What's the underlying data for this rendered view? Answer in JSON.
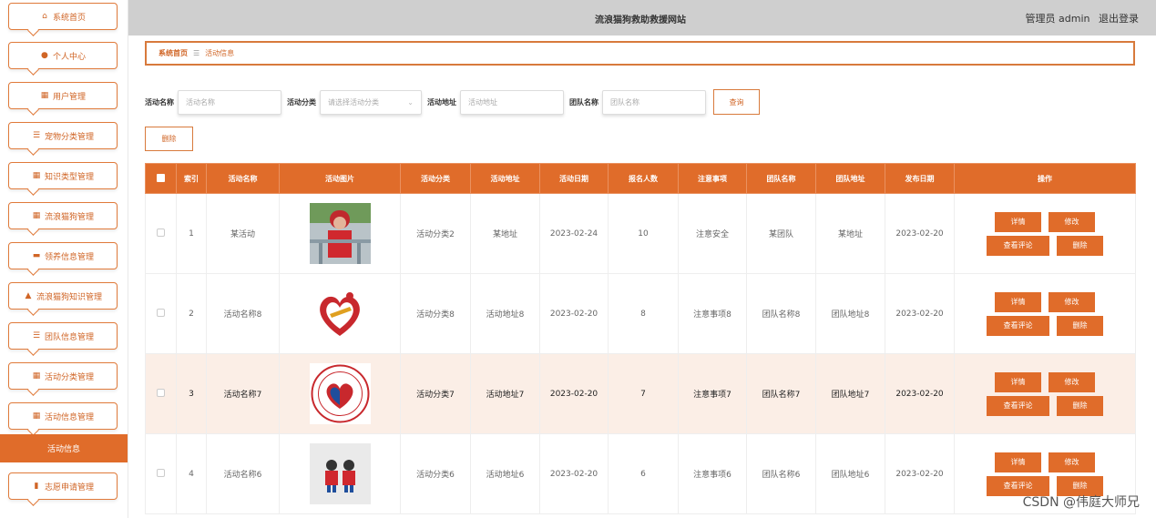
{
  "header": {
    "site_title": "流浪猫狗救助救援网站",
    "user": "管理员 admin",
    "logout": "退出登录"
  },
  "sidebar": {
    "items": [
      {
        "label": "系统首页",
        "icon": "home-icon",
        "glyph": "⌂"
      },
      {
        "label": "个人中心",
        "icon": "user-icon",
        "glyph": "●"
      },
      {
        "label": "用户管理",
        "icon": "grid-icon",
        "glyph": "▦"
      },
      {
        "label": "宠物分类管理",
        "icon": "list-icon",
        "glyph": "☰"
      },
      {
        "label": "知识类型管理",
        "icon": "grid-icon",
        "glyph": "▦"
      },
      {
        "label": "流浪猫狗管理",
        "icon": "grid-icon",
        "glyph": "▦"
      },
      {
        "label": "领养信息管理",
        "icon": "ticket-icon",
        "glyph": "▬"
      },
      {
        "label": "流浪猫狗知识管理",
        "icon": "thumb-icon",
        "glyph": "▲"
      },
      {
        "label": "团队信息管理",
        "icon": "sliders-icon",
        "glyph": "☰"
      },
      {
        "label": "活动分类管理",
        "icon": "grid-icon",
        "glyph": "▦"
      },
      {
        "label": "活动信息管理",
        "icon": "grid-icon",
        "glyph": "▦"
      },
      {
        "label": "志愿申请管理",
        "icon": "clipboard-icon",
        "glyph": "▮"
      }
    ],
    "active": "活动信息"
  },
  "breadcrumb": {
    "home": "系统首页",
    "sep": "☰",
    "current": "活动信息"
  },
  "search": {
    "name_label": "活动名称",
    "name_placeholder": "活动名称",
    "cat_label": "活动分类",
    "cat_placeholder": "请选择活动分类",
    "addr_label": "活动地址",
    "addr_placeholder": "活动地址",
    "team_label": "团队名称",
    "team_placeholder": "团队名称",
    "query": "查询"
  },
  "delete_button": "删除",
  "table": {
    "headers": [
      "索引",
      "活动名称",
      "活动图片",
      "活动分类",
      "活动地址",
      "活动日期",
      "报名人数",
      "注意事项",
      "团队名称",
      "团队地址",
      "发布日期",
      "操作"
    ],
    "rows": [
      {
        "index": "1",
        "name": "某活动",
        "image": "volunteer-photo",
        "category": "活动分类2",
        "address": "某地址",
        "date": "2023-02-24",
        "count": "10",
        "notes": "注意安全",
        "team": "某团队",
        "team_addr": "某地址",
        "publish": "2023-02-20"
      },
      {
        "index": "2",
        "name": "活动名称8",
        "image": "heart-logo",
        "category": "活动分类8",
        "address": "活动地址8",
        "date": "2023-02-20",
        "count": "8",
        "notes": "注意事项8",
        "team": "团队名称8",
        "team_addr": "团队地址8",
        "publish": "2023-02-20"
      },
      {
        "index": "3",
        "name": "活动名称7",
        "image": "circle-badge",
        "category": "活动分类7",
        "address": "活动地址7",
        "date": "2023-02-20",
        "count": "7",
        "notes": "注意事项7",
        "team": "团队名称7",
        "team_addr": "团队地址7",
        "publish": "2023-02-20"
      },
      {
        "index": "4",
        "name": "活动名称6",
        "image": "volunteer-figures",
        "category": "活动分类6",
        "address": "活动地址6",
        "date": "2023-02-20",
        "count": "6",
        "notes": "注意事项6",
        "team": "团队名称6",
        "team_addr": "团队地址6",
        "publish": "2023-02-20"
      }
    ],
    "ops": {
      "detail": "详情",
      "edit": "修改",
      "comments": "查看评论",
      "delete": "删除"
    }
  },
  "watermark": "CSDN @伟庭大师兄",
  "colors": {
    "accent": "#e06c2a",
    "header_bg": "#cfcfcf",
    "highlight_row": "#fbeee6"
  }
}
